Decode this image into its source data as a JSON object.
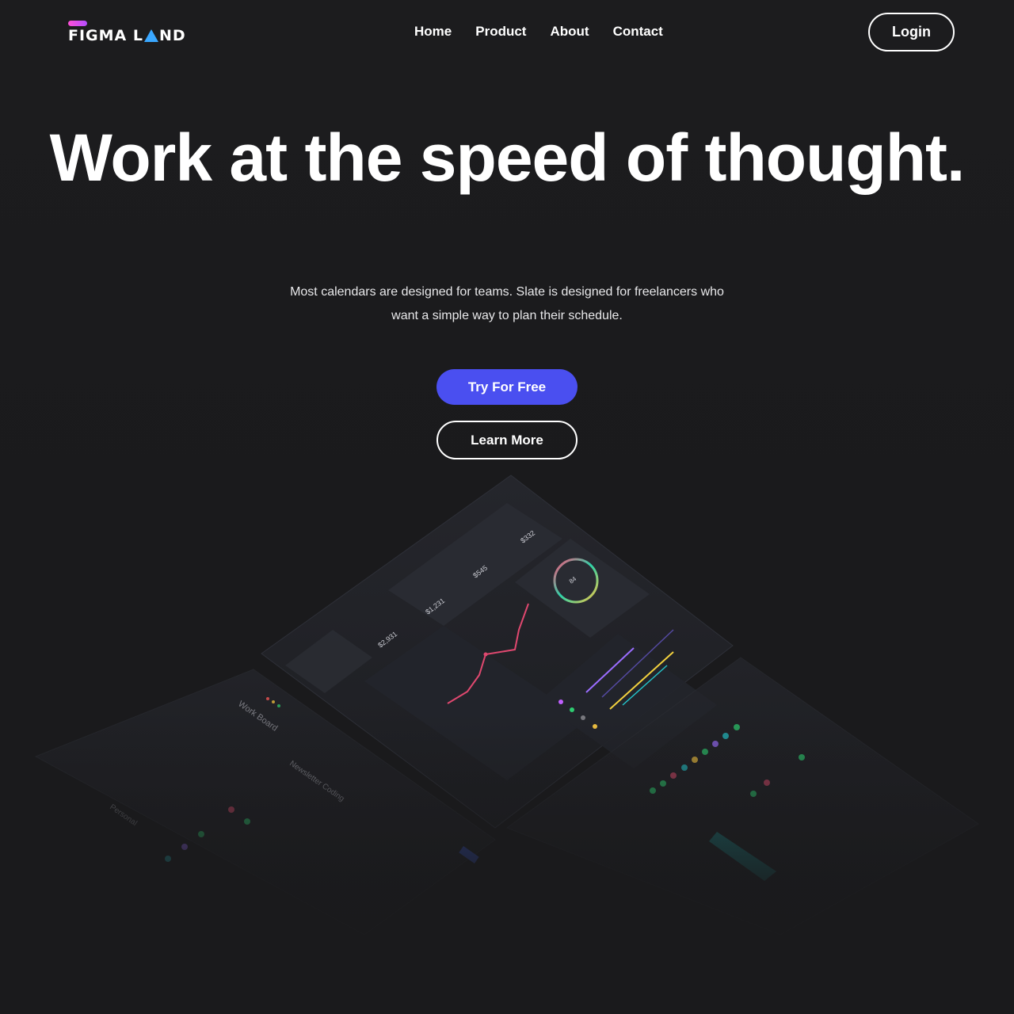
{
  "header": {
    "logo_text_part1": "FIGMA L",
    "logo_text_part2": "ND",
    "nav": [
      "Home",
      "Product",
      "About",
      "Contact"
    ],
    "login_label": "Login"
  },
  "hero": {
    "title": "Work at the speed of thought.",
    "subtitle": "Most calendars are designed for teams. Slate is designed for freelancers who want a simple way to plan their schedule.",
    "primary_cta": "Try For Free",
    "secondary_cta": "Learn More"
  },
  "dashboard_preview": {
    "stats": [
      "$2,931",
      "$1,231",
      "$545",
      "$332"
    ],
    "donut_value": "84",
    "board_title": "Work Board",
    "card_title": "Newsletter Coding",
    "section_label": "Personal"
  },
  "colors": {
    "background": "#1b1b1d",
    "primary": "#4a4ff0",
    "logo_gradient_start": "#ff4fd8",
    "logo_accent": "#3aa7ff"
  }
}
